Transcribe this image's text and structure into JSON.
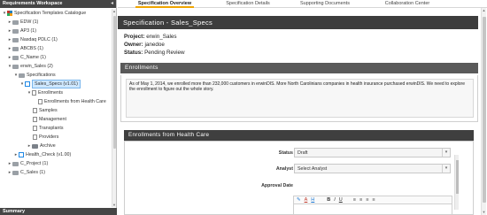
{
  "workspace": {
    "title": "Requirements Workspace",
    "collapse_icon": "chevron-left-icon",
    "footer": "Summary",
    "tree": [
      {
        "label": "Specification Templates Catalogue",
        "toggle": "▾",
        "icon": "catalogue-icon"
      },
      {
        "label": "EDW (1)",
        "toggle": "▸",
        "icon": "folder-icon"
      },
      {
        "label": "AP3 (1)",
        "toggle": "▸",
        "icon": "folder-icon"
      },
      {
        "label": "Nasdaq PDLC (1)",
        "toggle": "▸",
        "icon": "folder-icon"
      },
      {
        "label": "ABCBS (1)",
        "toggle": "▸",
        "icon": "folder-icon"
      },
      {
        "label": "C_Name (1)",
        "toggle": "▸",
        "icon": "folder-icon"
      },
      {
        "label": "erwin_Sales (2)",
        "toggle": "▾",
        "icon": "folder-icon"
      },
      {
        "label": "Specifications",
        "toggle": "▾",
        "icon": "folder-icon"
      },
      {
        "label": "Sales_Specs (v1.01)",
        "toggle": "▾",
        "icon": "specification-icon"
      },
      {
        "label": "Enrollments",
        "toggle": "▾",
        "icon": "document-icon"
      },
      {
        "label": "Enrollments from Health Care",
        "toggle": "",
        "icon": "document-icon"
      },
      {
        "label": "Samples",
        "toggle": "",
        "icon": "document-icon"
      },
      {
        "label": "Management",
        "toggle": "",
        "icon": "document-icon"
      },
      {
        "label": "Transplants",
        "toggle": "",
        "icon": "document-icon"
      },
      {
        "label": "Providers",
        "toggle": "",
        "icon": "document-icon"
      },
      {
        "label": "Archive",
        "toggle": "▸",
        "icon": "folder-icon"
      },
      {
        "label": "Health_Check (v1.00)",
        "toggle": "▸",
        "icon": "specification-icon"
      },
      {
        "label": "C_Project (1)",
        "toggle": "▸",
        "icon": "folder-icon"
      },
      {
        "label": "C_Sales (1)",
        "toggle": "▸",
        "icon": "folder-icon"
      }
    ]
  },
  "tabs": [
    {
      "label": "Specification Overview",
      "active": true
    },
    {
      "label": "Specification Details",
      "active": false
    },
    {
      "label": "Supporting Documents",
      "active": false
    },
    {
      "label": "Collaboration Center",
      "active": false
    }
  ],
  "specification": {
    "title": "Specification - Sales_Specs",
    "project_label": "Project:",
    "project_value": "erwin_Sales",
    "owner_label": "Owner:",
    "owner_value": "janedoe",
    "status_label": "Status:",
    "status_value": "Pending Review"
  },
  "enrollments": {
    "header": "Enrollments",
    "text": "As of May 1, 2014, we enrolled more than 232,000 customers in erwinDIS. More North Carolinians companies in health insurance purchased erwinDIS. We need to explore the enrollment to figure out the whole story."
  },
  "health_care": {
    "header": "Enrollments from Health Care",
    "status_label": "Status",
    "status_value": "Draft",
    "analyst_label": "Analyst",
    "analyst_value": "Select Analyst",
    "approval_label": "Approval Date",
    "toolbar": [
      "A",
      "H",
      "B",
      "I",
      "U"
    ]
  },
  "colors": {
    "active_tab_underline": "#f0a500",
    "header_dark": "#3d3d3d",
    "selection": "#cfe8ff"
  }
}
